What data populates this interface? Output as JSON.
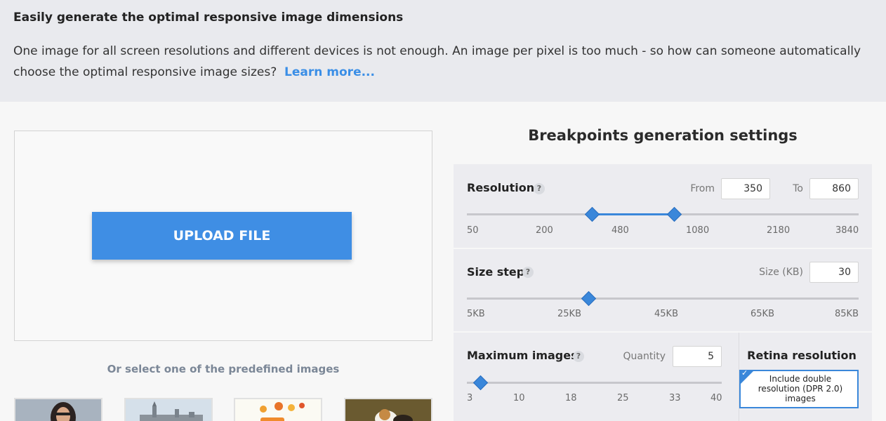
{
  "intro": {
    "title": "Easily generate the optimal responsive image dimensions",
    "description": "One image for all screen resolutions and different devices is not enough. An image per pixel is too much - so how can someone automatically choose the optimal responsive image sizes?",
    "learn_more": "Learn more..."
  },
  "upload": {
    "button_label": "UPLOAD FILE",
    "predefined_label": "Or select one of the predefined images"
  },
  "settings": {
    "title": "Breakpoints generation settings",
    "resolution": {
      "label": "Resolution",
      "help": "?",
      "from_label": "From",
      "from_value": "350",
      "to_label": "To",
      "to_value": "860",
      "ticks": [
        "50",
        "200",
        "480",
        "1080",
        "2180",
        "3840"
      ]
    },
    "size_step": {
      "label": "Size step",
      "help": "?",
      "size_label": "Size (KB)",
      "size_value": "30",
      "ticks": [
        "5KB",
        "25KB",
        "45KB",
        "65KB",
        "85KB"
      ]
    },
    "max_images": {
      "label": "Maximum images",
      "help": "?",
      "quantity_label": "Quantity",
      "quantity_value": "5",
      "ticks": [
        "3",
        "10",
        "18",
        "25",
        "33",
        "40"
      ]
    },
    "retina": {
      "title": "Retina resolution",
      "option_label": "Include double resolution (DPR 2.0) images",
      "checked": true
    }
  },
  "colors": {
    "accent": "#3a87da",
    "upload_button": "#3f8ee4",
    "link": "#3a8ee6"
  }
}
